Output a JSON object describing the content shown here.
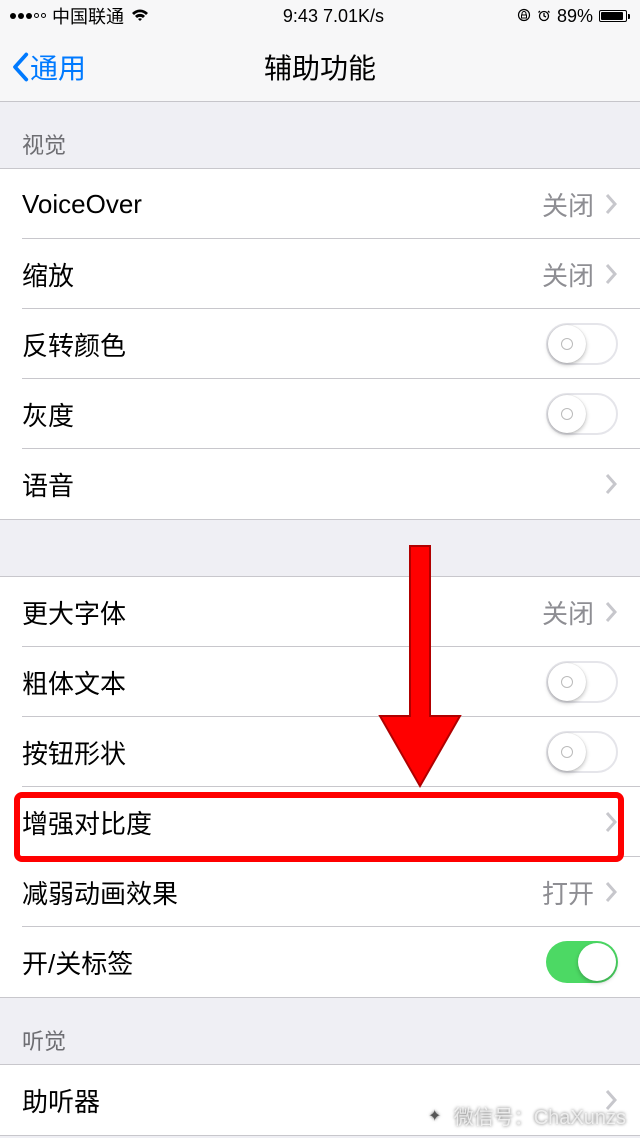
{
  "status": {
    "carrier": "中国联通",
    "time": "9:43",
    "speed": "7.01K/s",
    "battery": "89%"
  },
  "nav": {
    "back": "通用",
    "title": "辅助功能"
  },
  "sections": {
    "vision_header": "视觉",
    "hearing_header": "听觉"
  },
  "rows": {
    "voiceover": {
      "label": "VoiceOver",
      "value": "关闭"
    },
    "zoom": {
      "label": "缩放",
      "value": "关闭"
    },
    "invert": {
      "label": "反转颜色"
    },
    "grayscale": {
      "label": "灰度"
    },
    "speech": {
      "label": "语音"
    },
    "larger_text": {
      "label": "更大字体",
      "value": "关闭"
    },
    "bold_text": {
      "label": "粗体文本"
    },
    "button_shapes": {
      "label": "按钮形状"
    },
    "contrast": {
      "label": "增强对比度"
    },
    "reduce_motion": {
      "label": "减弱动画效果",
      "value": "打开"
    },
    "onoff_labels": {
      "label": "开/关标签"
    },
    "hearing_aids": {
      "label": "助听器"
    }
  },
  "watermark": {
    "text": "微信号：ChaXunzs"
  }
}
